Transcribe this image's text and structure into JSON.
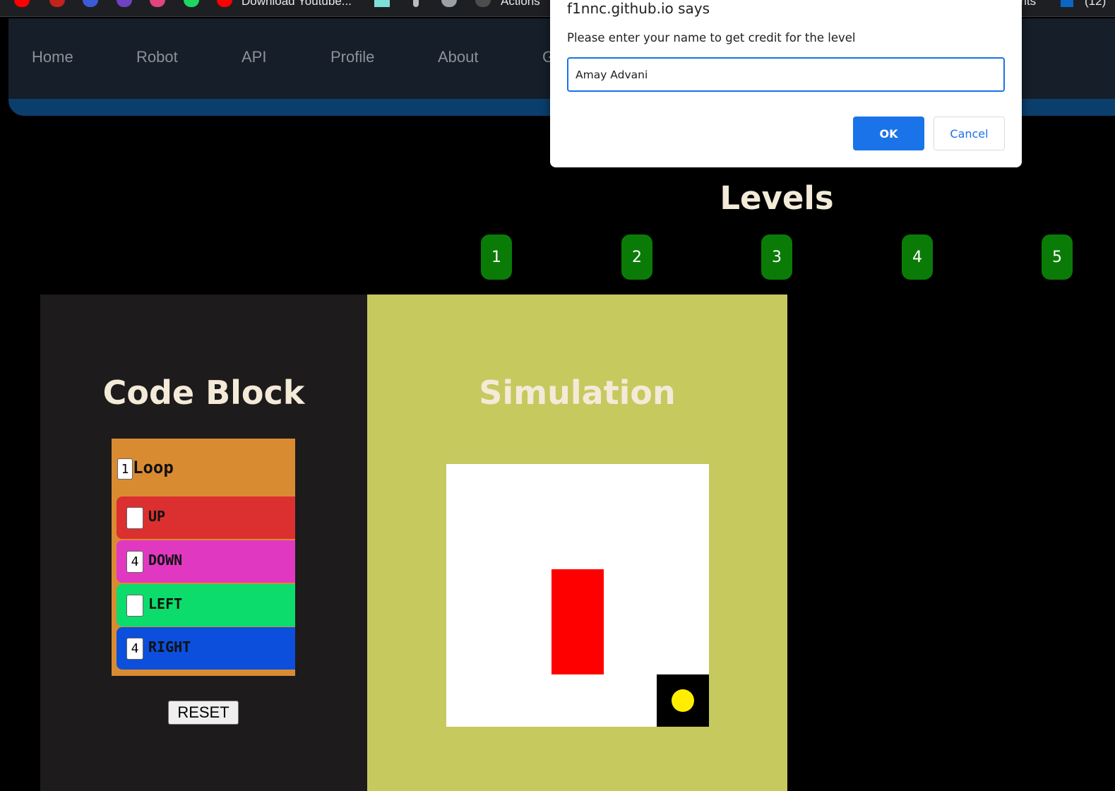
{
  "bookmarks": {
    "items": [
      {
        "icon": "youtube-icon",
        "label": ""
      },
      {
        "icon": "red-spider-icon",
        "label": ""
      },
      {
        "icon": "globe-icon",
        "label": ""
      },
      {
        "icon": "multicolor-icon",
        "label": ""
      },
      {
        "icon": "circle-icon",
        "label": ""
      },
      {
        "icon": "spotify-icon",
        "label": ""
      },
      {
        "icon": "youtube-icon",
        "label": "Download Youtube..."
      },
      {
        "icon": "teal-square-icon",
        "label": ""
      },
      {
        "icon": "music-note-icon",
        "label": ""
      },
      {
        "icon": "search-icon",
        "label": ""
      },
      {
        "icon": "github-icon",
        "label": "Actions"
      },
      {
        "icon": "doc-icon",
        "label": "ents"
      },
      {
        "icon": "linkedin-icon",
        "label": "(12)"
      }
    ]
  },
  "nav": {
    "links": [
      "Home",
      "Robot",
      "API",
      "Profile",
      "About",
      "G"
    ]
  },
  "levels": {
    "title": "Levels",
    "buttons": [
      "1",
      "2",
      "3",
      "4",
      "5"
    ]
  },
  "code_block": {
    "title": "Code Block",
    "loop": {
      "count": "1",
      "label": "Loop"
    },
    "commands": [
      {
        "label": "UP",
        "value": "",
        "color": "#dc2f2f"
      },
      {
        "label": "DOWN",
        "value": "4",
        "color": "#e138c2"
      },
      {
        "label": "LEFT",
        "value": "",
        "color": "#0bdc6b"
      },
      {
        "label": "RIGHT",
        "value": "4",
        "color": "#0b4fdc"
      }
    ],
    "reset_label": "RESET"
  },
  "simulation": {
    "title": "Simulation"
  },
  "dialog": {
    "origin": "f1nnc.github.io says",
    "message": "Please enter your name to get credit for the level",
    "input_value": "Amay Advani",
    "ok_label": "OK",
    "cancel_label": "Cancel"
  },
  "colors": {
    "level_button": "#0a7b07",
    "dialog_accent": "#1a73e8",
    "sim_bg": "#c6c95e",
    "loop_block": "#d98b32"
  }
}
